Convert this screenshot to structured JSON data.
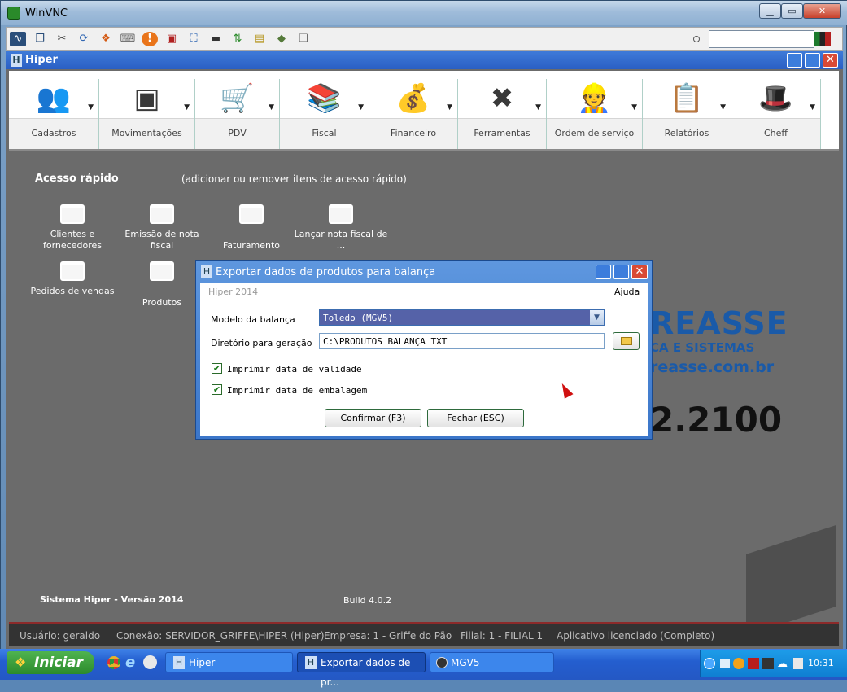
{
  "vnc": {
    "title": "WinVNC"
  },
  "hiper": {
    "title": "Hiper"
  },
  "ribbon": [
    {
      "label": "Cadastros",
      "icon": "users-icon"
    },
    {
      "label": "Movimentações",
      "icon": "box-icon"
    },
    {
      "label": "PDV",
      "icon": "cart-icon"
    },
    {
      "label": "Fiscal",
      "icon": "books-icon"
    },
    {
      "label": "Financeiro",
      "icon": "money-hand-icon"
    },
    {
      "label": "Ferramentas",
      "icon": "tools-icon"
    },
    {
      "label": "Ordem de serviço",
      "icon": "worker-icon"
    },
    {
      "label": "Relatórios",
      "icon": "clipboard-icon"
    },
    {
      "label": "Cheff",
      "icon": "chef-hat-icon"
    }
  ],
  "quick": {
    "title": "Acesso rápido",
    "hint": "(adicionar ou remover itens de acesso rápido)",
    "items": [
      "Clientes e fornecedores",
      "Emissão de nota fiscal",
      "Faturamento",
      "Lançar nota fiscal de ...",
      "Pedidos de vendas",
      "Produtos"
    ]
  },
  "brand": {
    "name": "REASSE",
    "sub": "CA E SISTEMAS",
    "site": "reasse.com.br",
    "phone": "2.2100"
  },
  "footer": {
    "version": "Sistema Hiper - Versão 2014",
    "build": "Build 4.0.2"
  },
  "status": {
    "user": "Usuário: geraldo",
    "conn": "Conexão: SERVIDOR_GRIFFE\\HIPER (Hiper)",
    "company": "Empresa: 1 - Griffe do Pão",
    "branch": "Filial: 1 - FILIAL 1",
    "license": "Aplicativo licenciado (Completo)"
  },
  "dialog": {
    "title": "Exportar dados de produtos para balança",
    "app": "Hiper 2014",
    "help": "Ajuda",
    "model_label": "Modelo da balança",
    "model_value": "Toledo (MGV5)",
    "dir_label": "Diretório para geração",
    "dir_value": "C:\\PRODUTOS BALANÇA TXT",
    "check1": "Imprimir data de validade",
    "check2": "Imprimir data de embalagem",
    "confirm": "Confirmar (F3)",
    "close": "Fechar (ESC)"
  },
  "taskbar": {
    "start": "Iniciar",
    "tasks": [
      "Hiper",
      "Exportar dados de pr...",
      "MGV5"
    ],
    "clock": "10:31"
  }
}
